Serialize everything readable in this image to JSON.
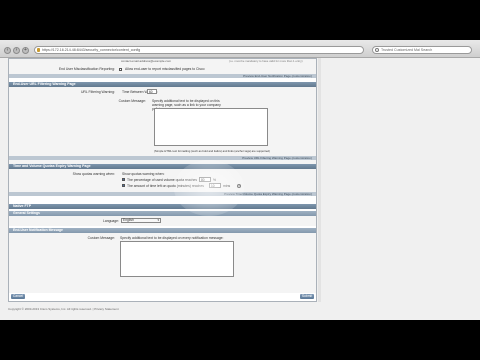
{
  "browser": {
    "url": "https://172.16.214.48:8443/security_connector/content_config",
    "search_placeholder": "Trusted Customized Mal Search"
  },
  "top_section": {
    "email_hint": "contact.email.address@example.com",
    "note_right": "(i.e. must be mandatory to have valid for more than 1 entry)",
    "row_label": "End User Misclassification Reporting:",
    "checkbox_text": "Allow end-user to report misclassified pages to Cisco",
    "footer": "Preview End-User Notification Page (customization)"
  },
  "warning_section": {
    "title": "End-User URL Filtering Warning Page",
    "row_label": "URL Filtering Warning:",
    "time_label": "Time Between Warning:",
    "time_value": "60",
    "custom_msg_label": "Custom Message:",
    "custom_msg_hint": "Specify additional text to be displayed on this warning page, such as a link to your company policies:",
    "html_note": "(Simple HTML text formatting (such as bold and italics) and links (anchor tags) are supported)",
    "footer": "Preview URL Filtering Warning Page (customization)"
  },
  "quota_section": {
    "title": "Time and Volume Quotas Expiry Warning Page",
    "row_label": "Show quotas warning when:",
    "intro": "Show quotas warning when:",
    "line1_prefix": "The percentage of used volume quota reaches",
    "line1_value": "80",
    "line1_suffix": "%",
    "line2_prefix": "The amount of time left on quota (minutes) reaches",
    "line2_value": "10",
    "line2_suffix": "mins",
    "help": "?",
    "footer": "Preview Time/Volume Quota Expiry Warning Page (customization)"
  },
  "native_ftp": {
    "title": "Native FTP",
    "general_title": "General Settings",
    "language_label": "Language:",
    "language_value": "English",
    "notif_title": "End-User Notification Message",
    "custom_label": "Custom Message:",
    "custom_hint": "Specify additional text to be displayed on every notification message:"
  },
  "buttons": {
    "cancel": "Cancel",
    "submit": "Submit"
  },
  "copyright": "Copyright © 2003-2013 Cisco Systems, Inc. All rights reserved. | Privacy Statement"
}
